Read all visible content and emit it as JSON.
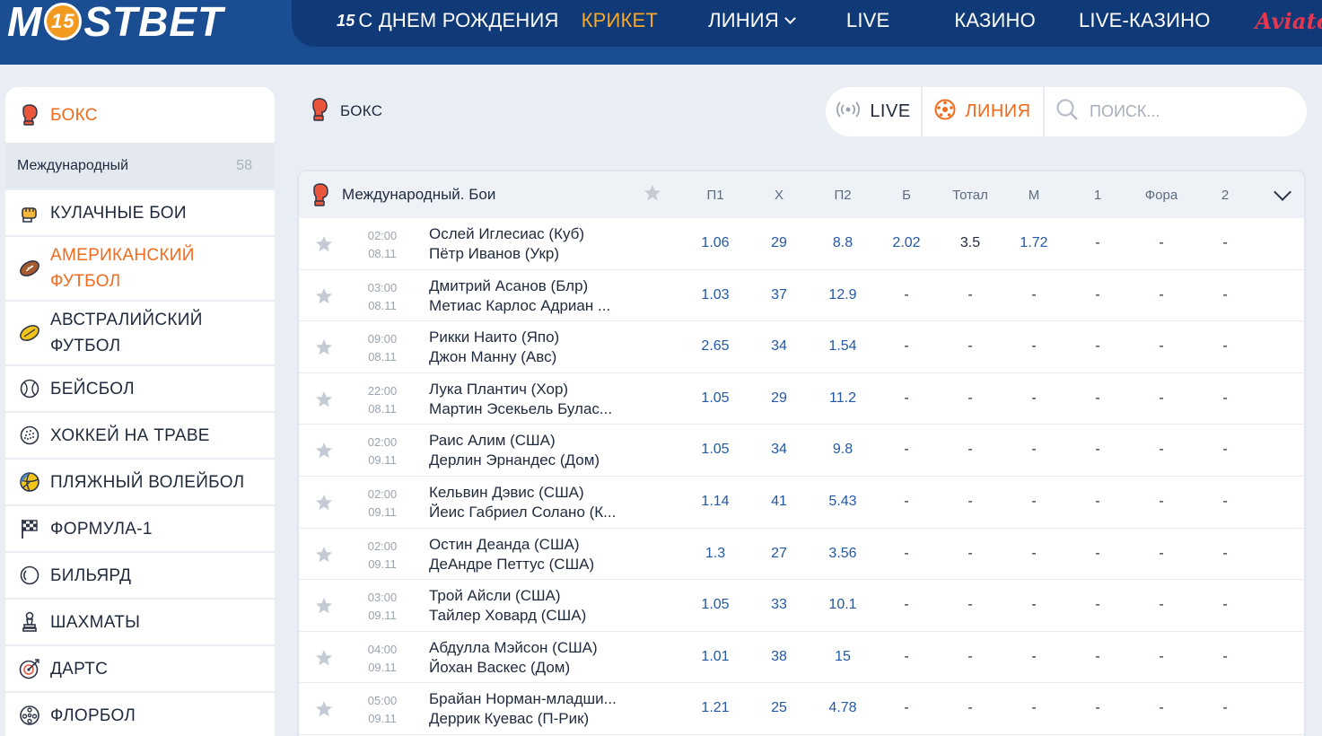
{
  "header": {
    "logo_left": "M",
    "logo_badge": "15",
    "logo_right": "STBET",
    "nav": {
      "birthday_icon": "15",
      "birthday": "С ДНЕМ РОЖДЕНИЯ",
      "cricket": "КРИКЕТ",
      "line": "ЛИНИЯ",
      "live": "LIVE",
      "casino": "КАЗИНО",
      "live_casino": "LIVE-КАЗИНО",
      "aviator": "Aviator"
    }
  },
  "sidebar": {
    "active": {
      "label": "БОКС",
      "icon": "boxing-glove-icon"
    },
    "sub": {
      "label": "Международный",
      "count": "58"
    },
    "items": [
      {
        "label": "КУЛАЧНЫЕ БОИ",
        "icon": "fist-icon"
      },
      {
        "label": "АМЕРИКАНСКИЙ",
        "label2": "ФУТБОЛ",
        "icon": "american-football-icon"
      },
      {
        "label": "АВСТРАЛИЙСКИЙ",
        "label2": "ФУТБОЛ",
        "icon": "australian-football-icon"
      },
      {
        "label": "БЕЙСБОЛ",
        "icon": "baseball-icon"
      },
      {
        "label": "ХОККЕЙ НА ТРАВЕ",
        "icon": "field-hockey-ball-icon"
      },
      {
        "label": "ПЛЯЖНЫЙ ВОЛЕЙБОЛ",
        "icon": "volleyball-icon"
      },
      {
        "label": "ФОРМУЛА-1",
        "icon": "checkered-flag-icon"
      },
      {
        "label": "БИЛЬЯРД",
        "icon": "billiard-ball-icon"
      },
      {
        "label": "ШАХМАТЫ",
        "icon": "chess-pawn-icon"
      },
      {
        "label": "ДАРТС",
        "icon": "darts-target-icon"
      },
      {
        "label": "ФЛОРБОЛ",
        "icon": "floorball-icon"
      }
    ]
  },
  "crumb": {
    "label": "БОКС"
  },
  "filter": {
    "live": "LIVE",
    "line": "ЛИНИЯ",
    "search_placeholder": "ПОИСК..."
  },
  "table": {
    "title": "Международный. Бои",
    "columns": [
      "П1",
      "Х",
      "П2",
      "Б",
      "Тотал",
      "М",
      "1",
      "Фора",
      "2"
    ],
    "rows": [
      {
        "time": "02:00",
        "date": "08.11",
        "team1": "Ослей Иглесиас (Куб)",
        "team2": "Пётр Иванов (Укр)",
        "odds": [
          "1.06",
          "29",
          "8.8",
          "2.02",
          "3.5",
          "1.72",
          "-",
          "-",
          "-"
        ]
      },
      {
        "time": "03:00",
        "date": "08.11",
        "team1": "Дмитрий Асанов (Блр)",
        "team2": "Метиас Карлос Адриан ...",
        "odds": [
          "1.03",
          "37",
          "12.9",
          "-",
          "-",
          "-",
          "-",
          "-",
          "-"
        ]
      },
      {
        "time": "09:00",
        "date": "08.11",
        "team1": "Рикки Наито (Япо)",
        "team2": "Джон Манну (Авс)",
        "odds": [
          "2.65",
          "34",
          "1.54",
          "-",
          "-",
          "-",
          "-",
          "-",
          "-"
        ]
      },
      {
        "time": "22:00",
        "date": "08.11",
        "team1": "Лука Плантич (Хор)",
        "team2": "Мартин Эсекьель Булас...",
        "odds": [
          "1.05",
          "29",
          "11.2",
          "-",
          "-",
          "-",
          "-",
          "-",
          "-"
        ]
      },
      {
        "time": "02:00",
        "date": "09.11",
        "team1": "Раис Алим (США)",
        "team2": "Дерлин Эрнандес (Дом)",
        "odds": [
          "1.05",
          "34",
          "9.8",
          "-",
          "-",
          "-",
          "-",
          "-",
          "-"
        ]
      },
      {
        "time": "02:00",
        "date": "09.11",
        "team1": "Кельвин Дэвис (США)",
        "team2": "Йеис Габриел Солано (К...",
        "odds": [
          "1.14",
          "41",
          "5.43",
          "-",
          "-",
          "-",
          "-",
          "-",
          "-"
        ]
      },
      {
        "time": "02:00",
        "date": "09.11",
        "team1": "Остин Деанда (США)",
        "team2": "ДеАндре Петтус (США)",
        "odds": [
          "1.3",
          "27",
          "3.56",
          "-",
          "-",
          "-",
          "-",
          "-",
          "-"
        ]
      },
      {
        "time": "03:00",
        "date": "09.11",
        "team1": "Трой Айсли (США)",
        "team2": "Тайлер Ховард (США)",
        "odds": [
          "1.05",
          "33",
          "10.1",
          "-",
          "-",
          "-",
          "-",
          "-",
          "-"
        ]
      },
      {
        "time": "04:00",
        "date": "09.11",
        "team1": "Абдулла Мэйсон (США)",
        "team2": "Йохан Васкес (Дом)",
        "odds": [
          "1.01",
          "38",
          "15",
          "-",
          "-",
          "-",
          "-",
          "-",
          "-"
        ]
      },
      {
        "time": "05:00",
        "date": "09.11",
        "team1": "Брайан Норман-младши...",
        "team2": "Деррик Куевас (П-Рик)",
        "odds": [
          "1.21",
          "25",
          "4.78",
          "-",
          "-",
          "-",
          "-",
          "-",
          "-"
        ]
      }
    ]
  },
  "colors": {
    "header_bg": "#1b4d92",
    "header_band": "#0f3a77",
    "accent_orange": "#f26a1b",
    "cricket_orange": "#f7a829",
    "odd_blue": "#2358a6",
    "aviator_red": "#e8364f"
  }
}
